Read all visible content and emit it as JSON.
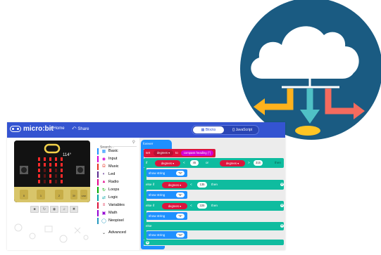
{
  "colors": {
    "topbar": "#3454d1",
    "cloud_circle": "#1a5b82",
    "logic_teal": "#0fbc9f",
    "variable_red": "#dc143c",
    "input_pink": "#d400d4",
    "arrow_orange": "#ffb21c",
    "arrow_salmon": "#f46b5e",
    "arrow_teal": "#4fc1c6"
  },
  "topbar": {
    "brand": "micro:bit",
    "home_label": "Home",
    "share_label": "Share",
    "blocks_label": "Blocks",
    "javascript_label": "{} JavaScript"
  },
  "simulator": {
    "compass_readout": "114°",
    "pin_labels": [
      "0",
      "1",
      "2",
      "3V",
      "GND"
    ],
    "controls": [
      "stop-icon",
      "restart-icon",
      "slowmo-icon",
      "mute-icon",
      "fullscreen-icon"
    ]
  },
  "toolbox": {
    "search_placeholder": "Search...",
    "categories": [
      {
        "label": "Basic",
        "color": "#1e90ff",
        "icon": "grid-icon"
      },
      {
        "label": "Input",
        "color": "#d400d4",
        "icon": "target-icon"
      },
      {
        "label": "Music",
        "color": "#e63022",
        "icon": "headphones-icon"
      },
      {
        "label": "Led",
        "color": "#5c2d91",
        "icon": "toggle-icon"
      },
      {
        "label": "Radio",
        "color": "#e3008c",
        "icon": "signal-icon"
      },
      {
        "label": "Loops",
        "color": "#00aa00",
        "icon": "loop-icon"
      },
      {
        "label": "Logic",
        "color": "#00a4a6",
        "icon": "shuffle-icon"
      },
      {
        "label": "Variables",
        "color": "#dc143c",
        "icon": "lines-icon"
      },
      {
        "label": "Math",
        "color": "#9400d3",
        "icon": "calculator-icon"
      },
      {
        "label": "Neopixel",
        "color": "#2699bf",
        "icon": "ring-icon"
      },
      {
        "label": "Advanced",
        "color": "#333333",
        "icon": "chevron-down-icon"
      }
    ]
  },
  "workspace": {
    "forever": "forever",
    "set": "set",
    "var_degrees": "degrees",
    "to": "to",
    "compass_heading": "compass heading (°)",
    "if": "if",
    "else_if": "else if",
    "else": "else",
    "then": "then",
    "or": "or",
    "lt": "<",
    "gt": ">",
    "show_string": "show string",
    "val_45": "45",
    "val_315": "315",
    "val_135": "135",
    "val_225": "225",
    "str_n": "\"N\"",
    "str_e": "\"E\"",
    "str_s": "\"S\"",
    "str_w": "\"W\""
  }
}
